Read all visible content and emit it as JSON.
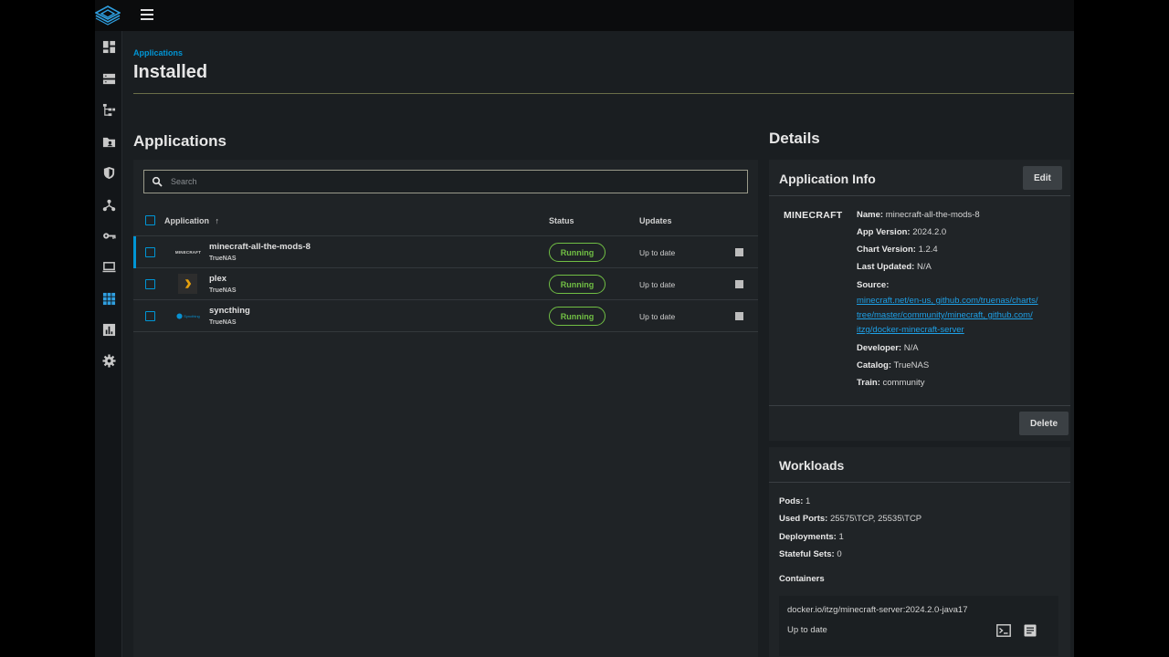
{
  "breadcrumb": "Applications",
  "page_title": "Installed",
  "applications": {
    "title": "Applications",
    "search_placeholder": "Search",
    "columns": {
      "application": "Application",
      "sort_indicator": "↑",
      "status": "Status",
      "updates": "Updates"
    },
    "rows": [
      {
        "name": "minecraft-all-the-mods-8",
        "catalog": "TrueNAS",
        "status": "Running",
        "updates": "Up to date",
        "logo": "minecraft-logo",
        "logo_text": "MINECRAFT"
      },
      {
        "name": "plex",
        "catalog": "TrueNAS",
        "status": "Running",
        "updates": "Up to date",
        "logo": "plex-logo"
      },
      {
        "name": "syncthing",
        "catalog": "TrueNAS",
        "status": "Running",
        "updates": "Up to date",
        "logo": "syncthing-logo",
        "logo_text": "Syncthing"
      }
    ]
  },
  "details": {
    "title": "Details",
    "app_info": {
      "title": "Application Info",
      "edit_label": "Edit",
      "delete_label": "Delete",
      "logo_text": "MINECRAFT",
      "name_label": "Name:",
      "name_value": "minecraft-all-the-mods-8",
      "app_version_label": "App Version:",
      "app_version_value": "2024.2.0",
      "chart_version_label": "Chart Version:",
      "chart_version_value": "1.2.4",
      "last_updated_label": "Last Updated:",
      "last_updated_value": "N/A",
      "source_label": "Source:",
      "source_links": [
        "minecraft.net/en-us",
        "github.com/truenas/charts/",
        "tree/master/community/minecraft",
        "github.com/",
        "itzg/docker-minecraft-server"
      ],
      "developer_label": "Developer:",
      "developer_value": "N/A",
      "catalog_label": "Catalog:",
      "catalog_value": "TrueNAS",
      "train_label": "Train:",
      "train_value": "community"
    },
    "workloads": {
      "title": "Workloads",
      "pods_label": "Pods:",
      "pods_value": "1",
      "ports_label": "Used Ports:",
      "ports_value": "25575\\TCP, 25535\\TCP",
      "deployments_label": "Deployments:",
      "deployments_value": "1",
      "stateful_label": "Stateful Sets:",
      "stateful_value": "0",
      "containers_label": "Containers",
      "container_image": "docker.io/itzg/minecraft-server:2024.2.0-java17",
      "container_status": "Up to date"
    }
  },
  "colors": {
    "accent": "#0095d5",
    "running": "#71bf44",
    "background": "#1a1e21"
  }
}
